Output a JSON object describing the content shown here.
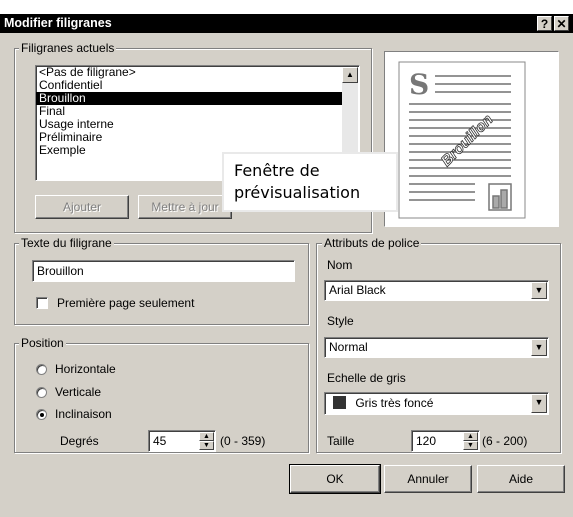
{
  "window": {
    "title": "Modifier filigranes",
    "help_glyph": "?",
    "close_glyph": "✕"
  },
  "current_watermarks": {
    "legend": "Filigranes actuels",
    "items": [
      "<Pas de filigrane>",
      "Confidentiel",
      "Brouillon",
      "Final",
      "Usage interne",
      "Préliminaire",
      "Exemple"
    ],
    "selected": "Brouillon",
    "add_label": "Ajouter",
    "update_label": "Mettre à jour"
  },
  "tooltip": {
    "text": "Fenêtre de\nprévisualisation"
  },
  "preview": {
    "letter": "S",
    "watermark_text": "Brouillon"
  },
  "watermark_text": {
    "legend": "Texte du filigrane",
    "value": "Brouillon",
    "first_page_label": "Première page seulement",
    "first_page_checked": false
  },
  "position": {
    "legend": "Position",
    "options": [
      "Horizontale",
      "Verticale",
      "Inclinaison"
    ],
    "selected": "Inclinaison",
    "degrees_label": "Degrés",
    "degrees_value": "45",
    "degrees_range": "(0 - 359)"
  },
  "font_attributes": {
    "legend": "Attributs de police",
    "name_label": "Nom",
    "name_value": "Arial Black",
    "style_label": "Style",
    "style_value": "Normal",
    "gray_label": "Echelle de gris",
    "gray_value": "Gris très foncé",
    "gray_swatch": "#333333",
    "size_label": "Taille",
    "size_value": "120",
    "size_range": "(6 - 200)"
  },
  "footer": {
    "ok_label": "OK",
    "cancel_label": "Annuler",
    "help_label": "Aide"
  }
}
